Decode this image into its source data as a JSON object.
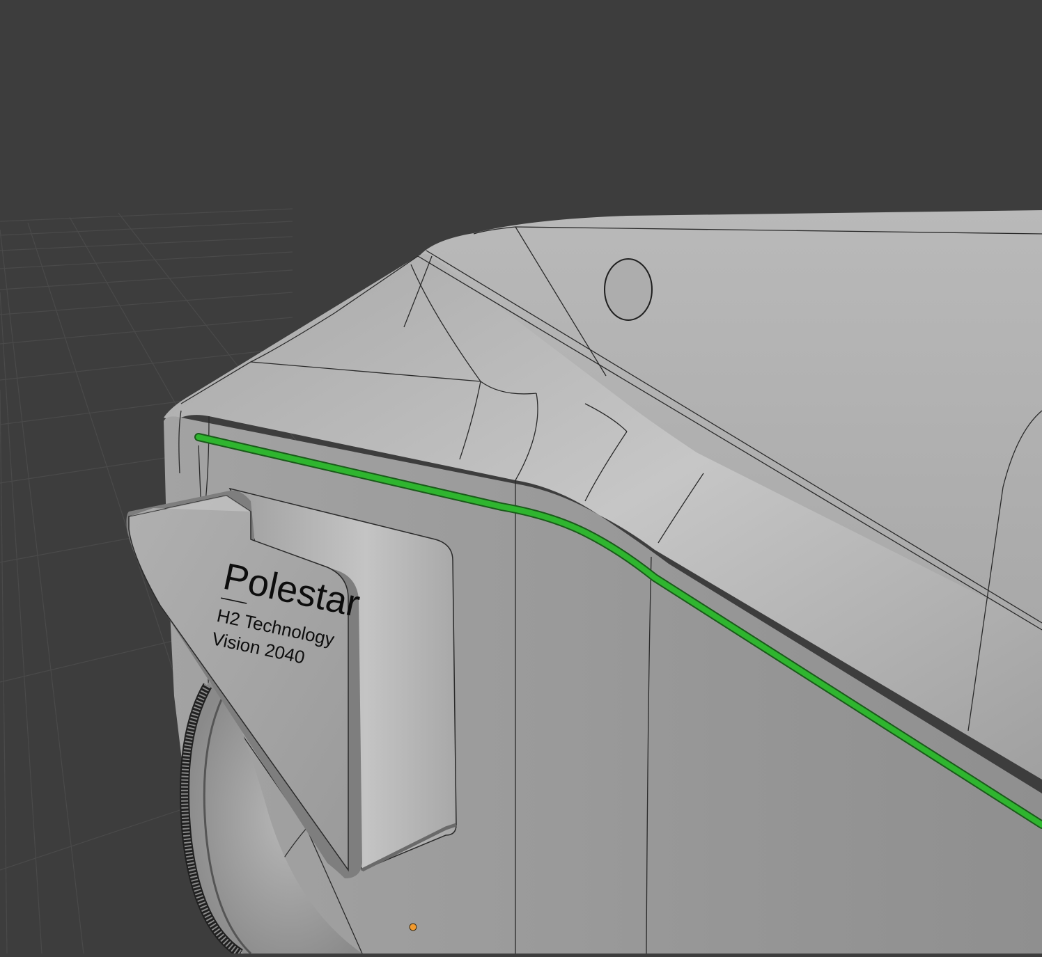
{
  "viewport": {
    "background_color": "#3d3d3d",
    "grid_color": "#4a4a4a",
    "body_color": "#9c9c9c",
    "highlight_color": "#c4c4c4",
    "wire_color": "#1a1a1a",
    "selected_edge_color": "#22b022",
    "origin_color": "#f29a2e"
  },
  "badge": {
    "brand": "Polestar",
    "line1": "H2 Technology",
    "line2": "Vision 2040"
  },
  "gizmo": {
    "origin_icon": "object-origin-dot"
  }
}
